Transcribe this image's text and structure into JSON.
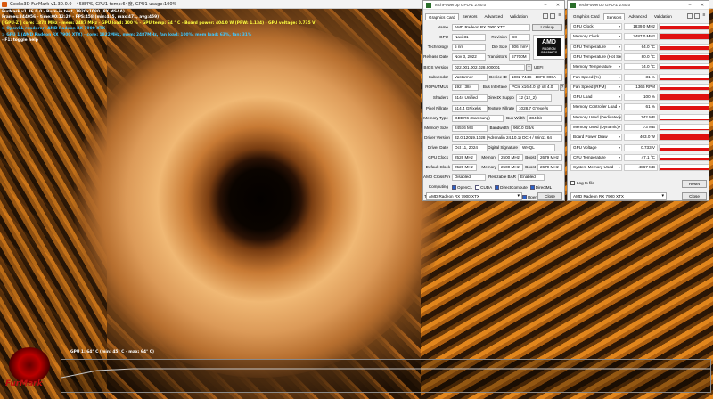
{
  "furmark": {
    "window_title": "Geeks3D FurMark v1.30.0.0 - 458FPS, GPU1 temp:64度, GPU1 usage:100%",
    "osd": [
      {
        "text": "FurMark v1.36.0.0 - Burn-in test, 1920x1080 (8X MSAA)",
        "color": "#ffffff"
      },
      {
        "text": "Frames:344056 - time:00:12:29 - FPS:458 (min:445, max:471, avg:459)",
        "color": "#ffffff"
      },
      {
        "text": "[ GPU-Z ] core: 1878 MHz - mem: 2487 MHz - GPU load: 100 % - GPU temp: 64 ° C - Board power: 404.0 W (PPW: 1.134) - GPU voltage: 0.735 V",
        "color": "#ffff40"
      },
      {
        "text": "> OpenGL renderer: AMD Radeon RX 7900 XTX",
        "color": "#40c8ff"
      },
      {
        "text": "> GPU 1 (AMD Radeon RX 7900 XTX) - core: 1822MHz, mem: 2487MHz, fan load: 100%, mem load: 63%, fan: 31%",
        "color": "#40c8ff"
      },
      {
        "text": "- F1: toggle help",
        "color": "#ffffff"
      }
    ],
    "graph_label": "GPU 1: 64° C (min: 45° C - max: 64° C)",
    "logo_text": "FurMark"
  },
  "gpuz_card": {
    "window_title": "TechPowerUp GPU-Z 2.60.0",
    "tabs": [
      "Graphics Card",
      "Sensors",
      "Advanced",
      "Validation"
    ],
    "active_tab": 0,
    "name": "AMD Radeon RX 7900 XTX",
    "lookup": "Lookup",
    "gpu": "Navi 31",
    "revision": "C8",
    "technology": "5 nm",
    "die_size": "306 mm²",
    "release_date": "Nov 3, 2022",
    "transistors": "57700M",
    "bios_version": "022.001.002.028.000001",
    "uefi": "UEFI",
    "subvendor": "Vastarmor",
    "device_id": "1002 744C - 1EFE 000A",
    "rops_tmus": "192 / 384",
    "bus_interface": "PCIe x16 4.0 @ x8 4.0",
    "shaders": "6144 Unified",
    "directx": "12 (12_2)",
    "pixel_fillrate": "514.4 GPixel/s",
    "texture_fillrate": "1028.7 GTexel/s",
    "memory_type": "GDDR6 (Samsung)",
    "bus_width": "384 bit",
    "memory_size": "24576 MB",
    "bandwidth": "960.0 GB/s",
    "driver_version": "32.0.12019.1028 (Adrenalin 24.10.1) DCH / Win11 64",
    "driver_date": "Oct 11, 2024",
    "digital_signature": "WHQL",
    "gpu_clock": "2526 MHz",
    "memory_clock": "2500 MHz",
    "boost_clock": "2679 MHz",
    "default_clock": "2526 MHz",
    "default_memory": "2500 MHz",
    "default_boost": "2679 MHz",
    "crossfire": "Disabled",
    "resizable_bar": "Enabled",
    "labels": {
      "name": "Name",
      "gpu": "GPU",
      "revision": "Revision",
      "technology": "Technology",
      "die_size": "Die Size",
      "release_date": "Release Date",
      "transistors": "Transistors",
      "bios": "BIOS Version",
      "subvendor": "Subvendor",
      "device_id": "Device ID",
      "rops": "ROPs/TMUs",
      "bus_interface": "Bus Interface",
      "shaders": "Shaders",
      "directx": "DirectX Support",
      "pixel": "Pixel Fillrate",
      "texture": "Texture Fillrate",
      "mem_type": "Memory Type",
      "bus_width": "Bus Width",
      "mem_size": "Memory Size",
      "bandwidth": "Bandwidth",
      "driver_version": "Driver Version",
      "driver_date": "Driver Date",
      "signature": "Digital Signature",
      "gpu_clock": "GPU Clock",
      "memory": "Memory",
      "boost": "Boost",
      "default_clock": "Default Clock",
      "crossfire": "AMD CrossFire",
      "rbar": "Resizable BAR",
      "computing": "Computing",
      "technologies": "Technologies"
    },
    "computing": [
      {
        "label": "OpenCL",
        "on": true
      },
      {
        "label": "CUDA",
        "on": false
      },
      {
        "label": "DirectCompute",
        "on": true
      },
      {
        "label": "DirectML",
        "on": true
      }
    ],
    "technologies": [
      {
        "label": "Vulkan",
        "on": true
      },
      {
        "label": "Ray Tracing",
        "on": true
      },
      {
        "label": "PhysX",
        "on": false
      },
      {
        "label": "OpenGL 4.6",
        "on": true
      }
    ],
    "logo": {
      "brand": "AMD",
      "sub": "RADEON GRAPHICS"
    },
    "selected_gpu": "AMD Radeon RX 7900 XTX",
    "close": "Close"
  },
  "gpuz_sensors": {
    "window_title": "TechPowerUp GPU-Z 2.60.0",
    "tabs": [
      "Graphics Card",
      "Sensors",
      "Advanced",
      "Validation"
    ],
    "active_tab": 1,
    "rows": [
      {
        "name": "GPU Clock",
        "value": "1839.0 MHz",
        "level": 0.72
      },
      {
        "name": "Memory Clock",
        "value": "2487.0 MHz",
        "level": 0.95
      },
      {
        "name": "GPU Temperature",
        "value": "64.0 °C",
        "level": 0.6
      },
      {
        "name": "GPU Temperature (Hot Spot)",
        "value": "80.0 °C",
        "level": 0.75
      },
      {
        "name": "Memory Temperature",
        "value": "74.0 °C",
        "level": 0.7
      },
      {
        "name": "Fan Speed (%)",
        "value": "31 %",
        "level": 0.31
      },
      {
        "name": "Fan Speed (RPM)",
        "value": "1366 RPM",
        "level": 0.45
      },
      {
        "name": "GPU Load",
        "value": "100 %",
        "level": 1.0
      },
      {
        "name": "Memory Controller Load",
        "value": "61 %",
        "level": 0.61
      },
      {
        "name": "Memory Used (Dedicated)",
        "value": "742 MB",
        "level": 0.05
      },
      {
        "name": "Memory Used (Dynamic)",
        "value": "73 MB",
        "level": 0.03
      },
      {
        "name": "Board Power Draw",
        "value": "403.0 W",
        "level": 0.95
      },
      {
        "name": "GPU Voltage",
        "value": "0.733 V",
        "level": 0.55
      },
      {
        "name": "CPU Temperature",
        "value": "47.1 °C",
        "level": 0.45
      },
      {
        "name": "System Memory Used",
        "value": "4867 MB",
        "level": 0.25
      }
    ],
    "log_to_file": "Log to file",
    "reset": "Reset",
    "selected_gpu": "AMD Radeon RX 7900 XTX",
    "close": "Close"
  }
}
